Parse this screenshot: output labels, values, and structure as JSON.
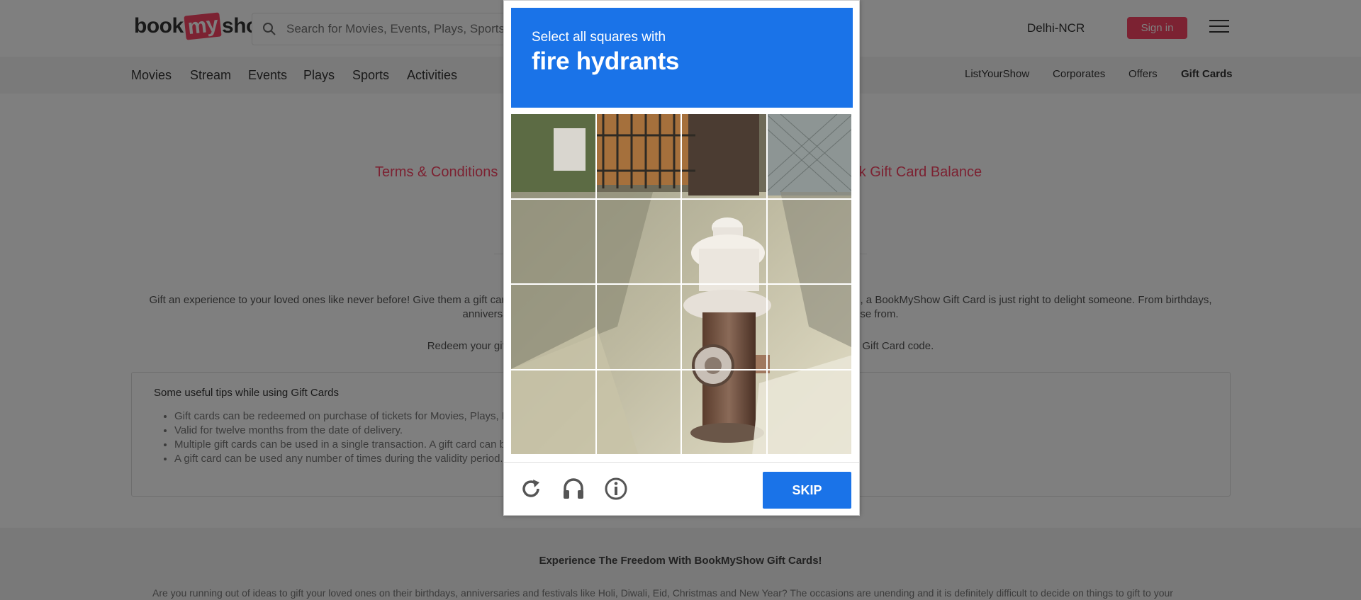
{
  "header": {
    "logo": {
      "part1": "book",
      "part2": "my",
      "part3": "show"
    },
    "search_placeholder": "Search for Movies, Events, Plays, Sports and Activities",
    "city": "Delhi-NCR",
    "signin_label": "Sign in"
  },
  "nav": {
    "left": [
      "Movies",
      "Stream",
      "Events",
      "Plays",
      "Sports",
      "Activities"
    ],
    "right": [
      "ListYourShow",
      "Corporates",
      "Offers",
      "Gift Cards"
    ]
  },
  "page": {
    "tab_terms": "Terms & Conditions",
    "tab_balance": "Check Gift Card Balance",
    "intro": "Gift an experience to your loved ones like never before! Give them a gift card to book tickets for movies, events, plays or sports. Whatever the occasion, a BookMyShow Gift Card is just right to delight someone. From birthdays, anniversaries, festivals to office celebrations, there are many gift cards you can choose from.",
    "redeem": "Redeem your gift card at the select payment page. Go to Gift Voucher option and enter your Gift Card code.",
    "tips_title": "Some useful tips while using Gift Cards",
    "tips": [
      "Gift cards can be redeemed on purchase of tickets for Movies, Plays, Events and Sports.",
      "Valid for twelve months from the date of delivery.",
      "Multiple gift cards can be used in a single transaction. A gift card can be used till its value is exhausted.",
      "A gift card can be used any number of times during the validity period."
    ],
    "footer_title": "Experience The Freedom With BookMyShow Gift Cards!",
    "footer_text": "Are you running out of ideas to gift your loved ones on their birthdays, anniversaries and festivals like Holi, Diwali, Eid, Christmas and New Year? The occasions are unending and it is definitely difficult to decide on things to gift to your"
  },
  "captcha": {
    "instruction": "Select all squares with",
    "target": "fire hydrants",
    "skip_label": "SKIP",
    "grid_rows": 4,
    "grid_cols": 4,
    "icons": [
      "reload-icon",
      "audio-challenge-icon",
      "info-icon"
    ]
  },
  "colors": {
    "brand": "#f84464",
    "captcha_blue": "#1a73e8"
  }
}
